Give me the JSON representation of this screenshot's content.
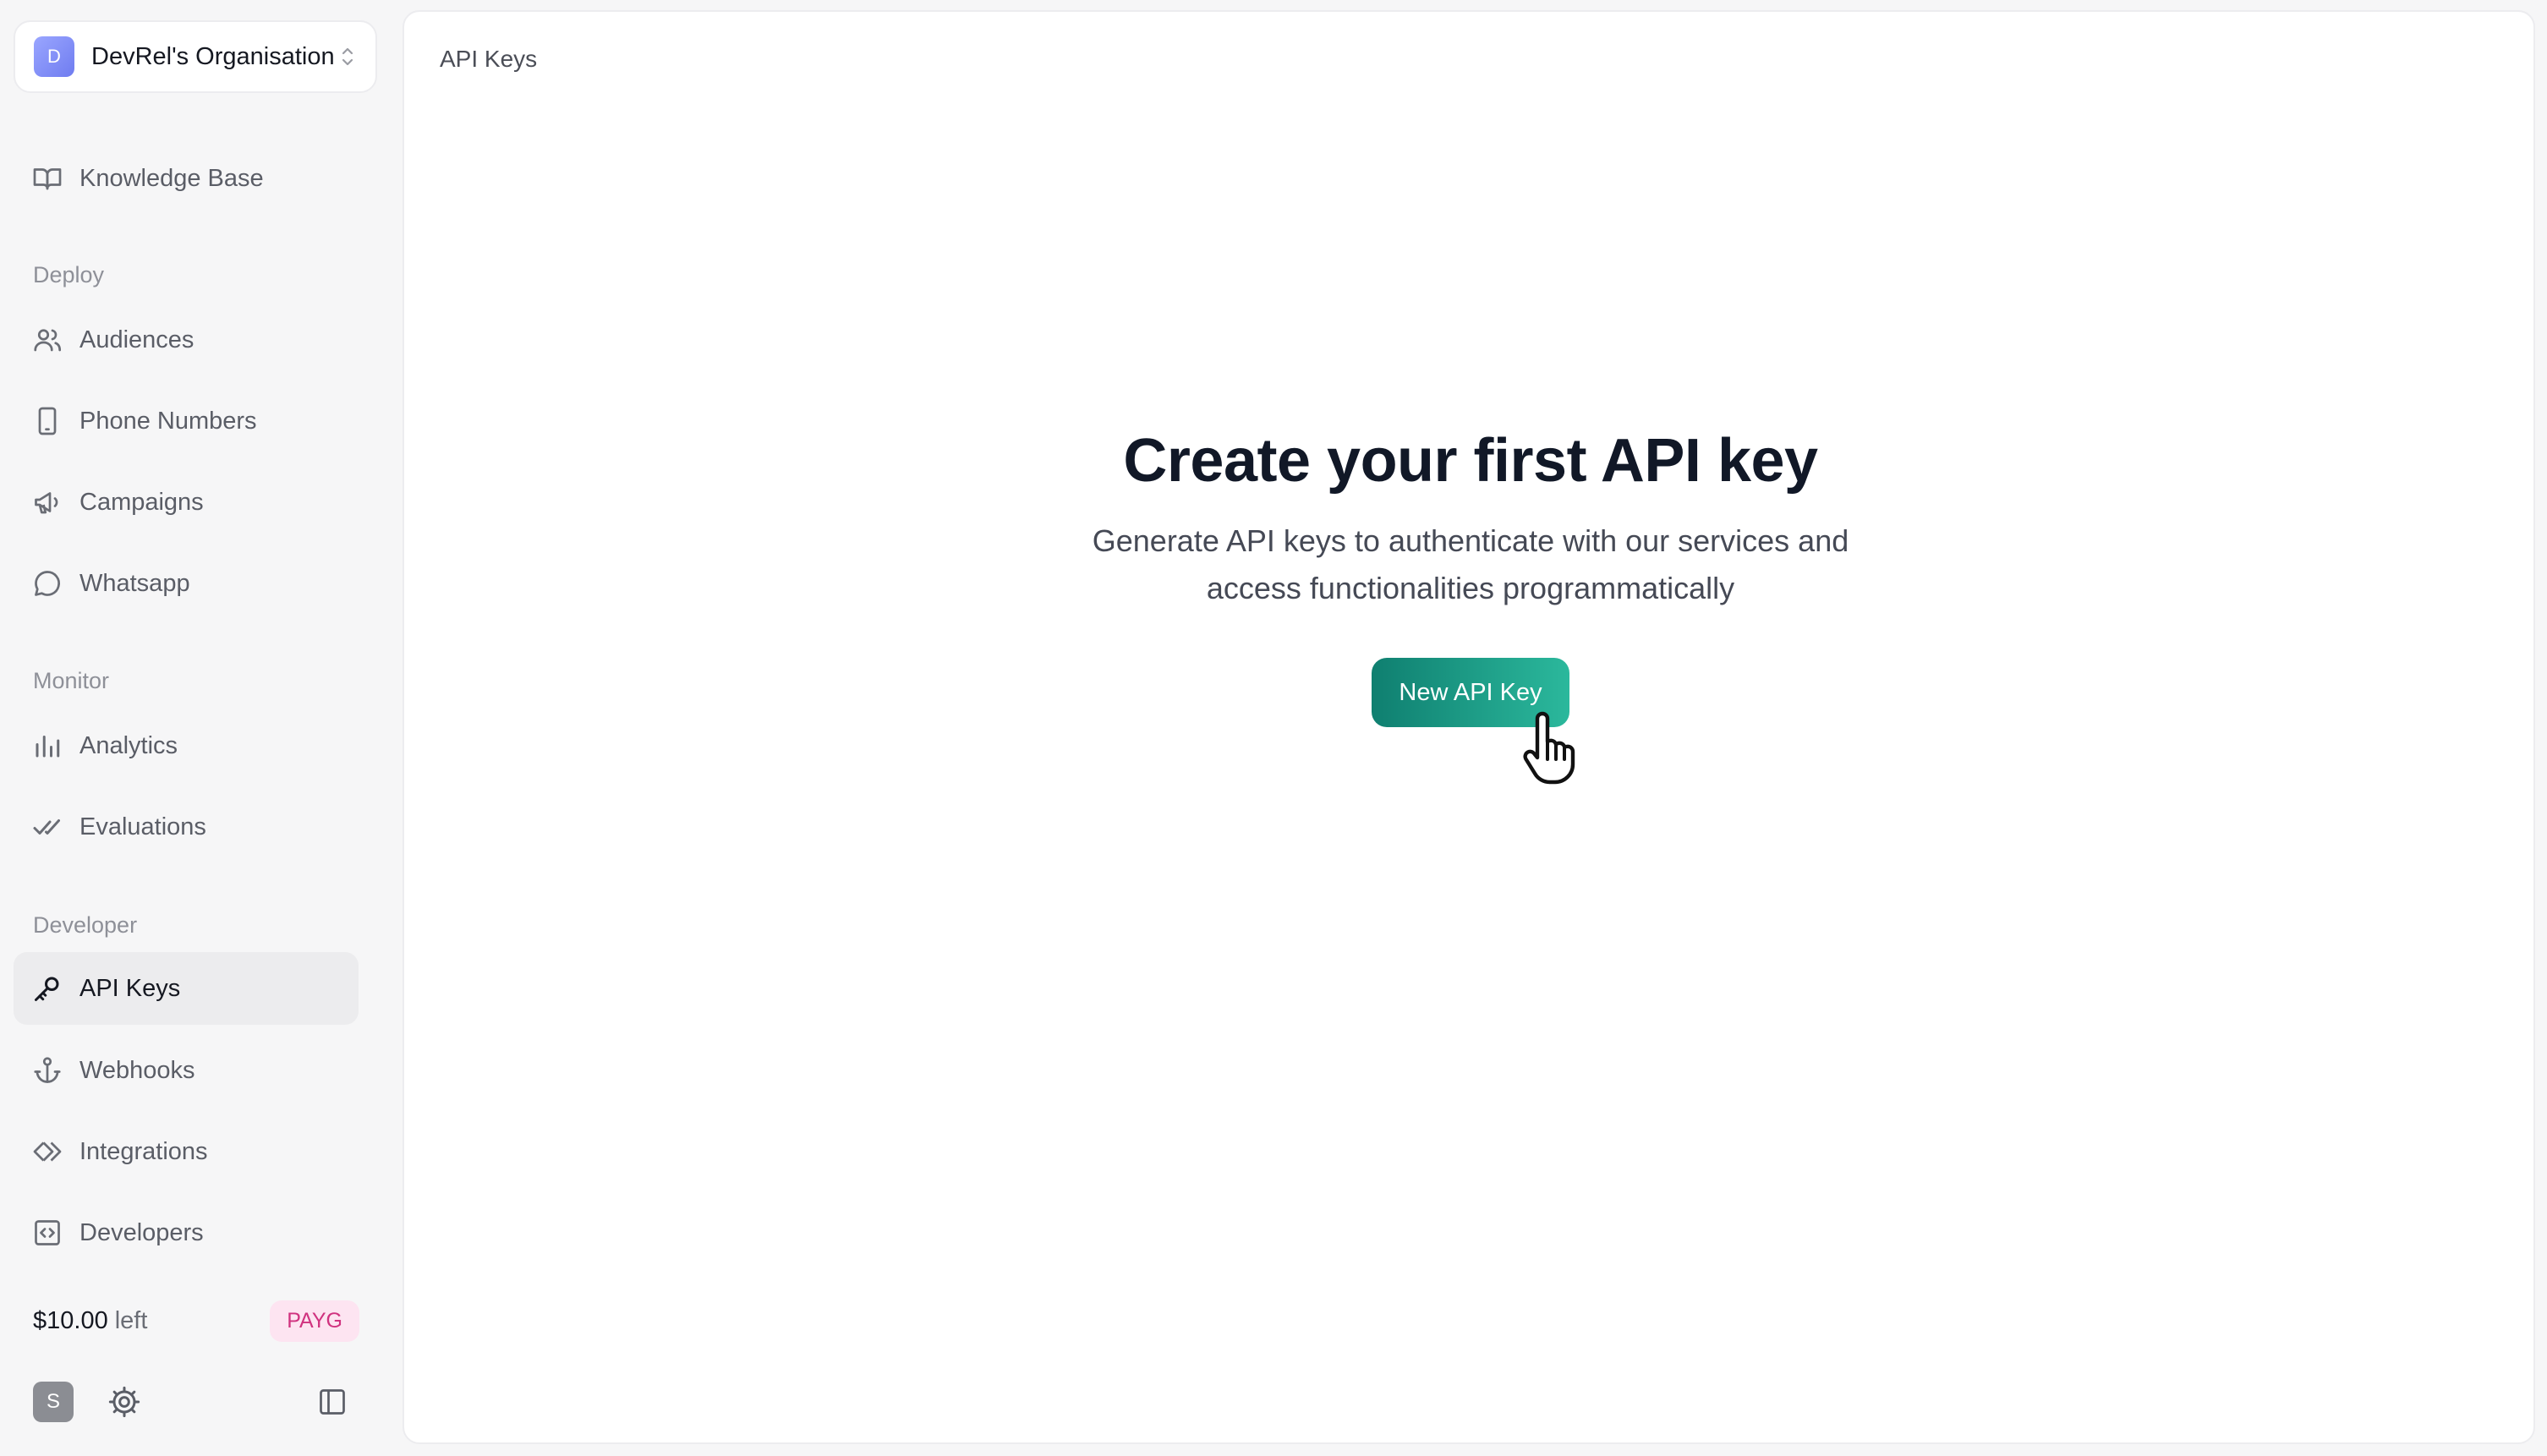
{
  "org": {
    "initial": "D",
    "name": "DevRel's Organisation"
  },
  "sidebar": {
    "knowledge_base": "Knowledge Base",
    "sections": {
      "deploy": "Deploy",
      "monitor": "Monitor",
      "developer": "Developer"
    },
    "items": {
      "audiences": "Audiences",
      "phone_numbers": "Phone Numbers",
      "campaigns": "Campaigns",
      "whatsapp": "Whatsapp",
      "analytics": "Analytics",
      "evaluations": "Evaluations",
      "api_keys": "API Keys",
      "webhooks": "Webhooks",
      "integrations": "Integrations",
      "developers": "Developers"
    },
    "active_item": "api_keys"
  },
  "billing": {
    "amount": "$10.00",
    "suffix": "left",
    "plan": "PAYG"
  },
  "user": {
    "initial": "S"
  },
  "main": {
    "breadcrumb": "API Keys",
    "empty_state": {
      "title": "Create your first API key",
      "description": "Generate API keys to authenticate with our services and access functionalities programmatically",
      "button_label": "New API Key"
    }
  },
  "colors": {
    "accent_start": "#0f7f70",
    "accent_end": "#2bb89c",
    "badge_bg": "#fde4f1",
    "badge_text": "#d0327f"
  }
}
